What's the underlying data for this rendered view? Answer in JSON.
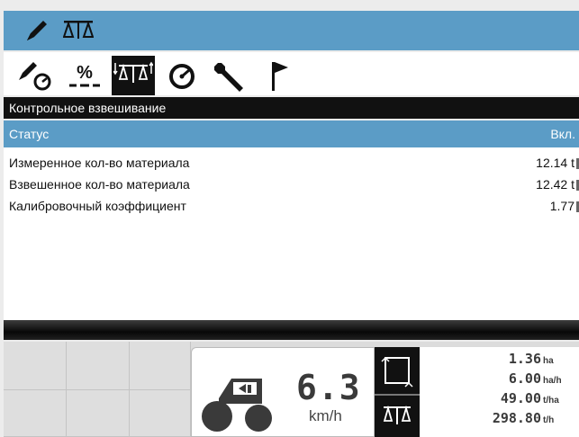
{
  "header": {
    "icons": [
      "pencil-icon",
      "scale-icon"
    ]
  },
  "toolbar": {
    "tools": [
      {
        "name": "pencil-gauge-icon"
      },
      {
        "name": "percent-icon",
        "label": "%"
      },
      {
        "name": "check-weighing-icon",
        "active": true
      },
      {
        "name": "gauge-icon"
      },
      {
        "name": "wrench-icon"
      },
      {
        "name": "flag-icon"
      }
    ]
  },
  "section": {
    "title": "Контрольное взвешивание"
  },
  "status": {
    "label": "Статус",
    "value": "Вкл."
  },
  "rows": [
    {
      "label": "Измеренное кол-во материала",
      "value": "12.14 t"
    },
    {
      "label": "Взвешенное кол-во материала",
      "value": "12.42 t"
    },
    {
      "label": "Калибровочный коэффициент",
      "value": "1.77"
    }
  ],
  "dashboard": {
    "speed": "6.3",
    "speed_unit": "km/h",
    "stats": [
      {
        "value": "1.36",
        "unit": "ha"
      },
      {
        "value": "6.00",
        "unit": "ha/h"
      },
      {
        "value": "49.00",
        "unit": "t/ha"
      },
      {
        "value": "298.80",
        "unit": "t/h"
      }
    ]
  },
  "colors": {
    "accent": "#5b9cc6",
    "header_dark": "#111111",
    "panel": "#ffffff"
  }
}
